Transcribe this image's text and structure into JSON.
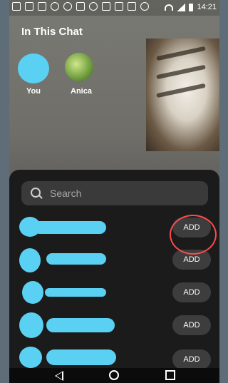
{
  "status_bar": {
    "time": "14:21"
  },
  "chat": {
    "title": "In This Chat",
    "participants": [
      {
        "label": "You"
      },
      {
        "label": "Anica"
      }
    ]
  },
  "search": {
    "placeholder": "Search"
  },
  "rows": [
    {
      "add_label": "ADD"
    },
    {
      "add_label": "ADD"
    },
    {
      "add_label": "ADD"
    },
    {
      "add_label": "ADD"
    },
    {
      "add_label": "ADD"
    }
  ],
  "colors": {
    "redaction": "#5ad1f2",
    "highlight_circle": "#ff4b4b",
    "sheet": "#1b1b1b"
  },
  "icons": [
    "search-icon",
    "back-icon",
    "home-icon",
    "recents-icon"
  ]
}
